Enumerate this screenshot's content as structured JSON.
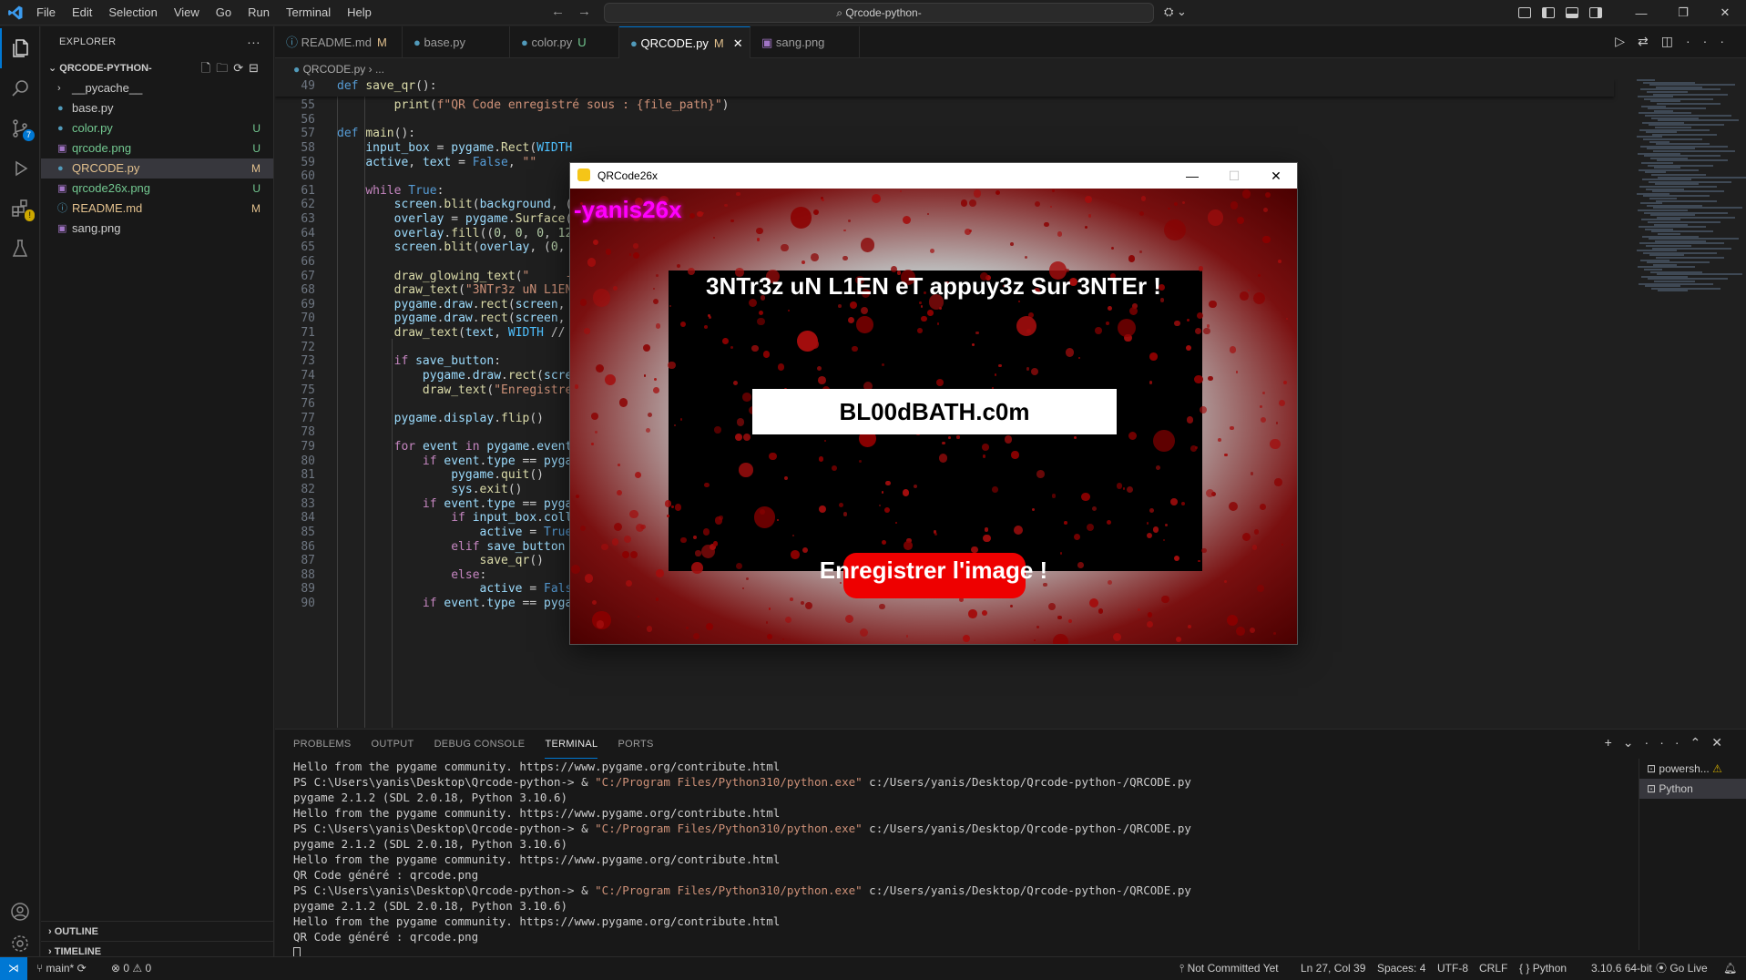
{
  "app": {
    "menu": [
      "File",
      "Edit",
      "Selection",
      "View",
      "Go",
      "Run",
      "Terminal",
      "Help"
    ],
    "search_text": "Qrcode-python-"
  },
  "sidebar": {
    "title": "EXPLORER",
    "root": "QRCODE-PYTHON-",
    "items": [
      {
        "name": "__pycache__",
        "status": "",
        "kind": "folder"
      },
      {
        "name": "base.py",
        "status": "",
        "kind": "py"
      },
      {
        "name": "color.py",
        "status": "U",
        "kind": "py"
      },
      {
        "name": "qrcode.png",
        "status": "U",
        "kind": "png"
      },
      {
        "name": "QRCODE.py",
        "status": "M",
        "kind": "py"
      },
      {
        "name": "qrcode26x.png",
        "status": "U",
        "kind": "png"
      },
      {
        "name": "README.md",
        "status": "M",
        "kind": "md"
      },
      {
        "name": "sang.png",
        "status": "",
        "kind": "png"
      }
    ],
    "outline": "OUTLINE",
    "timeline": "TIMELINE"
  },
  "tabs": [
    {
      "label": "README.md",
      "status": "M"
    },
    {
      "label": "base.py",
      "status": ""
    },
    {
      "label": "color.py",
      "status": "U"
    },
    {
      "label": "QRCODE.py",
      "status": "M"
    },
    {
      "label": "sang.png",
      "status": ""
    }
  ],
  "breadcrumb": {
    "file": "QRCODE.py",
    "rest": "..."
  },
  "editor": {
    "sticky": {
      "num": "49",
      "text": "def save_qr():"
    },
    "lines": [
      {
        "num": "55",
        "text": "        print(f\"QR Code enregistré sous : {file_path}\")"
      },
      {
        "num": "56",
        "text": ""
      },
      {
        "num": "57",
        "text": "def main():"
      },
      {
        "num": "58",
        "text": "    input_box = pygame.Rect(WIDTH"
      },
      {
        "num": "59",
        "text": "    active, text = False, \"\""
      },
      {
        "num": "60",
        "text": ""
      },
      {
        "num": "61",
        "text": "    while True:"
      },
      {
        "num": "62",
        "text": "        screen.blit(background, ("
      },
      {
        "num": "63",
        "text": "        overlay = pygame.Surface("
      },
      {
        "num": "64",
        "text": "        overlay.fill((0, 0, 0, 12"
      },
      {
        "num": "65",
        "text": "        screen.blit(overlay, (0, "
      },
      {
        "num": "66",
        "text": ""
      },
      {
        "num": "67",
        "text": "        draw_glowing_text(\"     -"
      },
      {
        "num": "68",
        "text": "        draw_text(\"3NTr3z uN L1EN"
      },
      {
        "num": "69",
        "text": "        pygame.draw.rect(screen, "
      },
      {
        "num": "70",
        "text": "        pygame.draw.rect(screen, "
      },
      {
        "num": "71",
        "text": "        draw_text(text, WIDTH // "
      },
      {
        "num": "72",
        "text": ""
      },
      {
        "num": "73",
        "text": "        if save_button:"
      },
      {
        "num": "74",
        "text": "            pygame.draw.rect(scre"
      },
      {
        "num": "75",
        "text": "            draw_text(\"Enregistre"
      },
      {
        "num": "76",
        "text": ""
      },
      {
        "num": "77",
        "text": "        pygame.display.flip()"
      },
      {
        "num": "78",
        "text": ""
      },
      {
        "num": "79",
        "text": "        for event in pygame.event"
      },
      {
        "num": "80",
        "text": "            if event.type == pyga"
      },
      {
        "num": "81",
        "text": "                pygame.quit()"
      },
      {
        "num": "82",
        "text": "                sys.exit()"
      },
      {
        "num": "83",
        "text": "            if event.type == pyga"
      },
      {
        "num": "84",
        "text": "                if input_box.coll"
      },
      {
        "num": "85",
        "text": "                    active = True"
      },
      {
        "num": "86",
        "text": "                elif save_button and save_button.collidepoint(event.pos):"
      },
      {
        "num": "87",
        "text": "                    save_qr()"
      },
      {
        "num": "88",
        "text": "                else:"
      },
      {
        "num": "89",
        "text": "                    active = False"
      },
      {
        "num": "90",
        "text": "            if event.type == pygame.KEYDOWN:"
      }
    ]
  },
  "pygame_window": {
    "title": "QRCode26x",
    "glow_text": "-yanis26x",
    "prompt": "3NTr3z uN L1EN eT appuy3z Sur 3NTEr !",
    "input_value": "BL00dBATH.c0m",
    "save_label": "Enregistrer l'image !"
  },
  "panel": {
    "tabs": [
      "PROBLEMS",
      "OUTPUT",
      "DEBUG CONSOLE",
      "TERMINAL",
      "PORTS"
    ],
    "active_tab": "TERMINAL",
    "terminal_lines": [
      "Hello from the pygame community. https://www.pygame.org/contribute.html",
      "PS C:\\Users\\yanis\\Desktop\\Qrcode-python-> & \"C:/Program Files/Python310/python.exe\" c:/Users/yanis/Desktop/Qrcode-python-/QRCODE.py",
      "pygame 2.1.2 (SDL 2.0.18, Python 3.10.6)",
      "Hello from the pygame community. https://www.pygame.org/contribute.html",
      "PS C:\\Users\\yanis\\Desktop\\Qrcode-python-> & \"C:/Program Files/Python310/python.exe\" c:/Users/yanis/Desktop/Qrcode-python-/QRCODE.py",
      "pygame 2.1.2 (SDL 2.0.18, Python 3.10.6)",
      "Hello from the pygame community. https://www.pygame.org/contribute.html",
      "QR Code généré : qrcode.png",
      "PS C:\\Users\\yanis\\Desktop\\Qrcode-python-> & \"C:/Program Files/Python310/python.exe\" c:/Users/yanis/Desktop/Qrcode-python-/QRCODE.py",
      "pygame 2.1.2 (SDL 2.0.18, Python 3.10.6)",
      "Hello from the pygame community. https://www.pygame.org/contribute.html",
      "QR Code généré : qrcode.png"
    ],
    "terminals": [
      "powersh...",
      "Python"
    ]
  },
  "statusbar": {
    "branch": "main*",
    "errors": "0",
    "warnings": "0",
    "commit": "Not Committed Yet",
    "position": "Ln 27, Col 39",
    "spaces": "Spaces: 4",
    "encoding": "UTF-8",
    "eol": "CRLF",
    "language": "Python",
    "interpreter": "3.10.6 64-bit",
    "golive": "Go Live"
  },
  "colors": {
    "accent": "#0078d4",
    "modified": "#e2c08d",
    "untracked": "#73c991",
    "save_button": "#ee0000",
    "glow": "#ff00ff"
  }
}
